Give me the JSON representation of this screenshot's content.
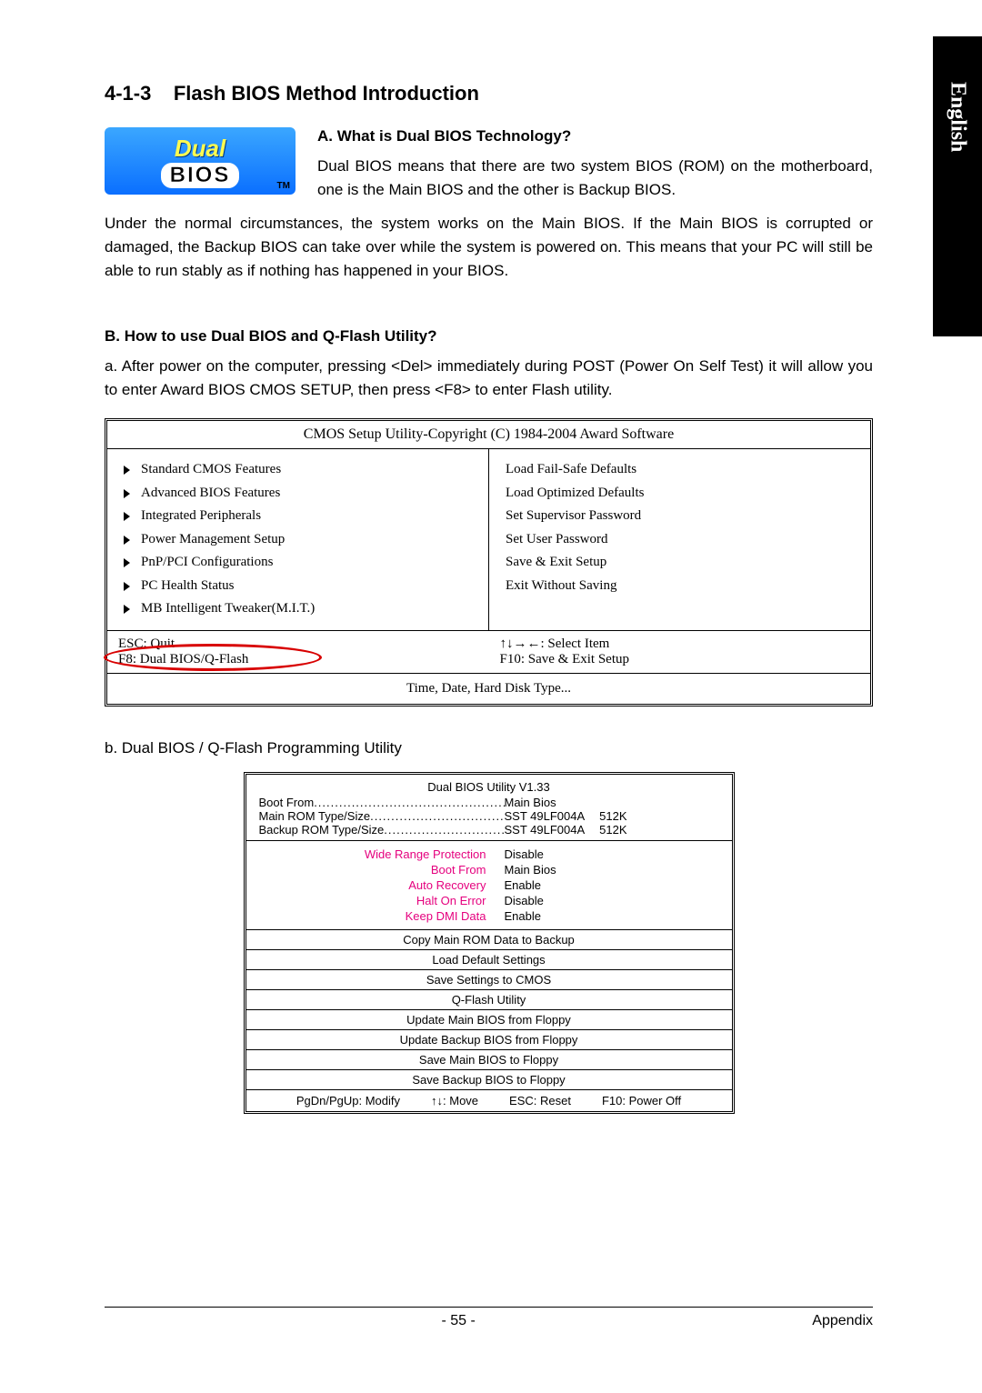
{
  "side_tab": "English",
  "section": {
    "number": "4-1-3",
    "title": "Flash BIOS Method Introduction"
  },
  "logo": {
    "line1": "Dual",
    "line2": "BIOS",
    "tm": "TM"
  },
  "sub_a": {
    "heading": "A.  What is Dual BIOS Technology?",
    "p1": "Dual BIOS means that there are two system BIOS (ROM) on the motherboard, one is the Main BIOS and the other is Backup BIOS.",
    "p2": "Under the normal circumstances, the system works on the Main BIOS. If the Main BIOS is corrupted or damaged, the Backup BIOS can take over while the system is powered on. This means that your PC will still be able to run stably as if nothing has happened in your BIOS."
  },
  "sub_b": {
    "heading": "B.  How to use Dual BIOS and Q-Flash Utility?",
    "p1": "a. After power on the computer, pressing <Del> immediately during POST (Power On Self Test) it will allow you to enter Award BIOS CMOS SETUP, then press <F8> to enter Flash utility."
  },
  "cmos": {
    "title": "CMOS Setup Utility-Copyright (C) 1984-2004 Award Software",
    "left": [
      "Standard CMOS Features",
      "Advanced BIOS Features",
      "Integrated Peripherals",
      "Power Management Setup",
      "PnP/PCI Configurations",
      "PC Health Status",
      "MB Intelligent Tweaker(M.I.T.)"
    ],
    "right": [
      "Load Fail-Safe Defaults",
      "Load Optimized Defaults",
      "Set Supervisor Password",
      "Set User Password",
      "Save & Exit Setup",
      "Exit Without Saving"
    ],
    "footer": {
      "esc": "ESC: Quit",
      "f8": "F8: Dual BIOS/Q-Flash",
      "sel": "↑↓→←: Select Item",
      "f10": "F10: Save & Exit Setup"
    },
    "help": "Time, Date, Hard Disk Type..."
  },
  "b2_label": "b.   Dual BIOS / Q-Flash Programming Utility",
  "dual_util": {
    "title": "Dual BIOS Utility V1.33",
    "info": [
      {
        "label": "Boot From",
        "v1": "Main Bios",
        "v2": ""
      },
      {
        "label": "Main ROM Type/Size",
        "v1": "SST 49LF004A",
        "v2": "512K"
      },
      {
        "label": "Backup ROM Type/Size",
        "v1": "SST 49LF004A",
        "v2": "512K"
      }
    ],
    "settings": [
      {
        "k": "Wide Range Protection",
        "v": "Disable"
      },
      {
        "k": "Boot From",
        "v": "Main Bios"
      },
      {
        "k": "Auto Recovery",
        "v": "Enable"
      },
      {
        "k": "Halt On Error",
        "v": "Disable"
      },
      {
        "k": "Keep DMI Data",
        "v": "Enable"
      }
    ],
    "actions_top": [
      "Copy Main ROM Data to Backup",
      "Load Default Settings",
      "Save Settings to CMOS"
    ],
    "qflash_label": "Q-Flash Utility",
    "actions_bot": [
      "Update Main BIOS from Floppy",
      "Update Backup BIOS from Floppy",
      "Save Main BIOS to Floppy",
      "Save Backup BIOS to Floppy"
    ],
    "keys": [
      "PgDn/PgUp: Modify",
      "↑↓: Move",
      "ESC: Reset",
      "F10: Power Off"
    ]
  },
  "footer": {
    "page": "- 55 -",
    "label": "Appendix"
  }
}
